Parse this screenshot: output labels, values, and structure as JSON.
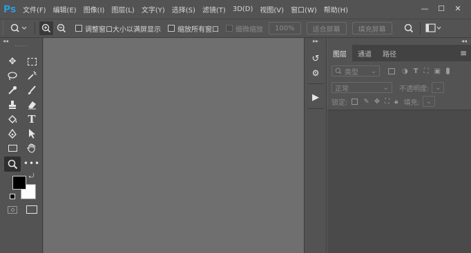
{
  "app": {
    "logo": "Ps",
    "menu": [
      "文件(F)",
      "编辑(E)",
      "图像(I)",
      "图层(L)",
      "文字(Y)",
      "选择(S)",
      "滤镜(T)",
      "3D(D)",
      "视图(V)",
      "窗口(W)",
      "帮助(H)"
    ]
  },
  "options": {
    "resize_windows_label": "调整窗口大小以满屏显示",
    "zoom_all_label": "缩放所有窗口",
    "scrubby_zoom_label": "细微缩放",
    "percent_label": "100%",
    "fit_screen_label": "适合屏幕",
    "fill_screen_label": "填充屏幕"
  },
  "panel": {
    "tabs": [
      "图层",
      "通道",
      "路径"
    ],
    "filter_kind": "类型",
    "blend_mode": "正常",
    "opacity_label": "不透明度:",
    "lock_label": "锁定:",
    "fill_label": "填充:"
  },
  "colors": {
    "brand": "#2f9bd8",
    "foreground": "#000000",
    "background": "#ffffff",
    "chrome": "#535353",
    "canvas": "#6f6f6f"
  }
}
